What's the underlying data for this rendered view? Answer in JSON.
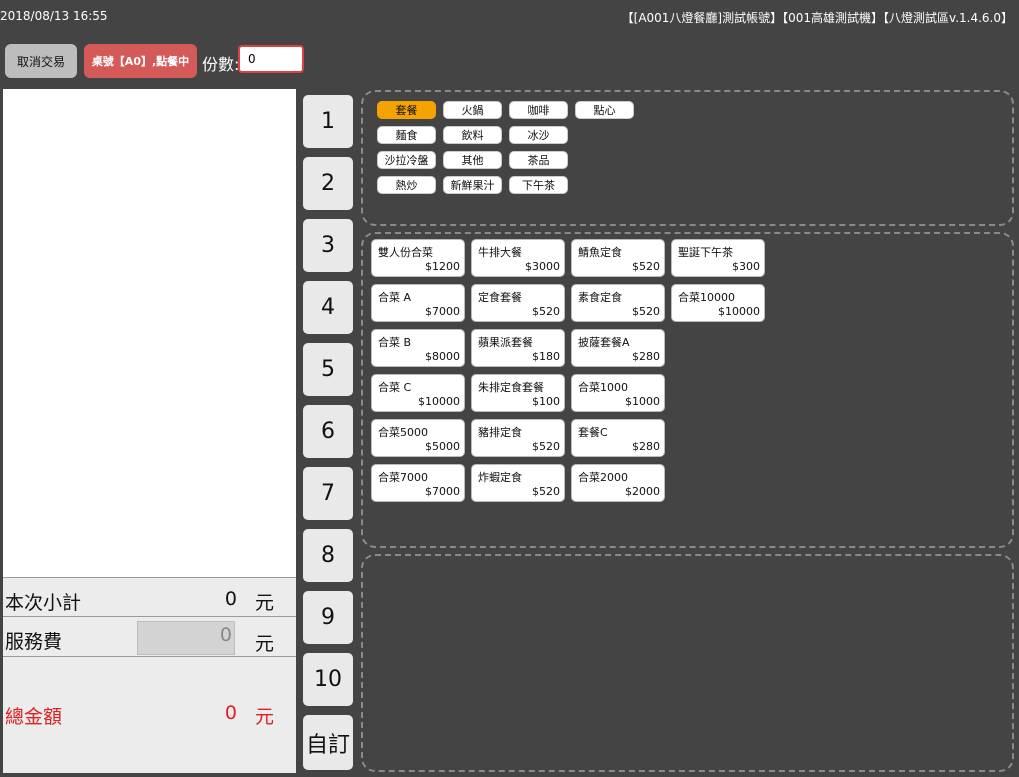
{
  "header": {
    "datetime": "2018/08/13 16:55",
    "title": "【[A001八燈餐廳]測試帳號】【001高雄測試機】【八燈測試區v.1.4.6.0】"
  },
  "toolbar": {
    "cancel_label": "取消交易",
    "table_label": "桌號【A0】,點餐中",
    "qty_label": "份數:",
    "qty_value": "0"
  },
  "summary": {
    "subtotal_label": "本次小計",
    "subtotal_value": "0",
    "service_label": "服務費",
    "service_value": "0",
    "total_label": "總金額",
    "total_value": "0",
    "unit": "元"
  },
  "number_buttons": [
    "1",
    "2",
    "3",
    "4",
    "5",
    "6",
    "7",
    "8",
    "9",
    "10",
    "自訂"
  ],
  "categories": [
    "套餐",
    "火鍋",
    "咖啡",
    "點心",
    "麵食",
    "飲料",
    "冰沙",
    "沙拉冷盤",
    "其他",
    "茶品",
    "熱炒",
    "新鮮果汁",
    "下午茶"
  ],
  "active_category": "套餐",
  "items": [
    {
      "name": "雙人份合菜",
      "price": "$1200"
    },
    {
      "name": "牛排大餐",
      "price": "$3000"
    },
    {
      "name": "鯖魚定食",
      "price": "$520"
    },
    {
      "name": "聖誕下午茶",
      "price": "$300"
    },
    {
      "name": "合菜 A",
      "price": "$7000"
    },
    {
      "name": "定食套餐",
      "price": "$520"
    },
    {
      "name": "素食定食",
      "price": "$520"
    },
    {
      "name": "合菜10000",
      "price": "$10000"
    },
    {
      "name": "合菜 B",
      "price": "$8000"
    },
    {
      "name": "蘋果派套餐",
      "price": "$180"
    },
    {
      "name": "披薩套餐A",
      "price": "$280"
    },
    {
      "name": "合菜 C",
      "price": "$10000"
    },
    {
      "name": "朱排定食套餐",
      "price": "$100"
    },
    {
      "name": "合菜1000",
      "price": "$1000"
    },
    {
      "name": "合菜5000",
      "price": "$5000"
    },
    {
      "name": "豬排定食",
      "price": "$520"
    },
    {
      "name": "套餐C",
      "price": "$280"
    },
    {
      "name": "合菜7000",
      "price": "$7000"
    },
    {
      "name": "炸蝦定食",
      "price": "$520"
    },
    {
      "name": "合菜2000",
      "price": "$2000"
    }
  ],
  "colors": {
    "background": "#444444",
    "active_category": "#f5a300",
    "table_button": "#d45a5a",
    "total_text": "#e02020"
  }
}
